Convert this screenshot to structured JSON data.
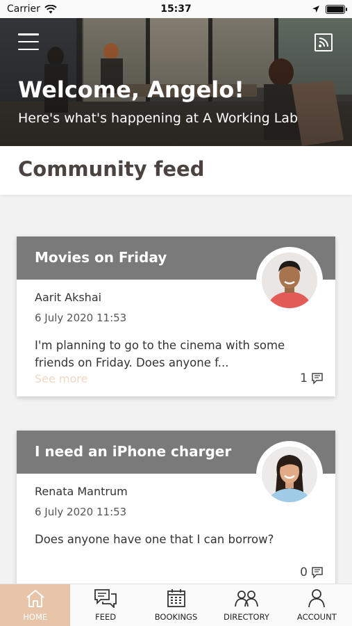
{
  "status_bar": {
    "carrier": "Carrier",
    "time": "15:37"
  },
  "hero": {
    "title": "Welcome, Angelo!",
    "subtitle": "Here's what's happening at A Working Lab"
  },
  "section": {
    "title": "Community feed"
  },
  "posts": [
    {
      "title": "Movies on Friday",
      "author": "Aarit Akshai",
      "date": "6 July 2020 11:53",
      "text": "I'm planning to go to the cinema with some friends on Friday. Does anyone f...",
      "see_more": "See more",
      "comment_count": "1"
    },
    {
      "title": "I need an iPhone charger",
      "author": "Renata Mantrum",
      "date": "6 July 2020 11:53",
      "text": "Does anyone have one that I can borrow?",
      "comment_count": "0"
    }
  ],
  "tabs": [
    {
      "label": "HOME",
      "icon": "home-icon"
    },
    {
      "label": "FEED",
      "icon": "chat-icon"
    },
    {
      "label": "BOOKINGS",
      "icon": "calendar-icon"
    },
    {
      "label": "DIRECTORY",
      "icon": "people-icon"
    },
    {
      "label": "ACCOUNT",
      "icon": "person-icon"
    }
  ],
  "colors": {
    "accent": "#e8c4a9",
    "card_header": "#7a7a7a",
    "see_more": "#f1d7c4"
  }
}
